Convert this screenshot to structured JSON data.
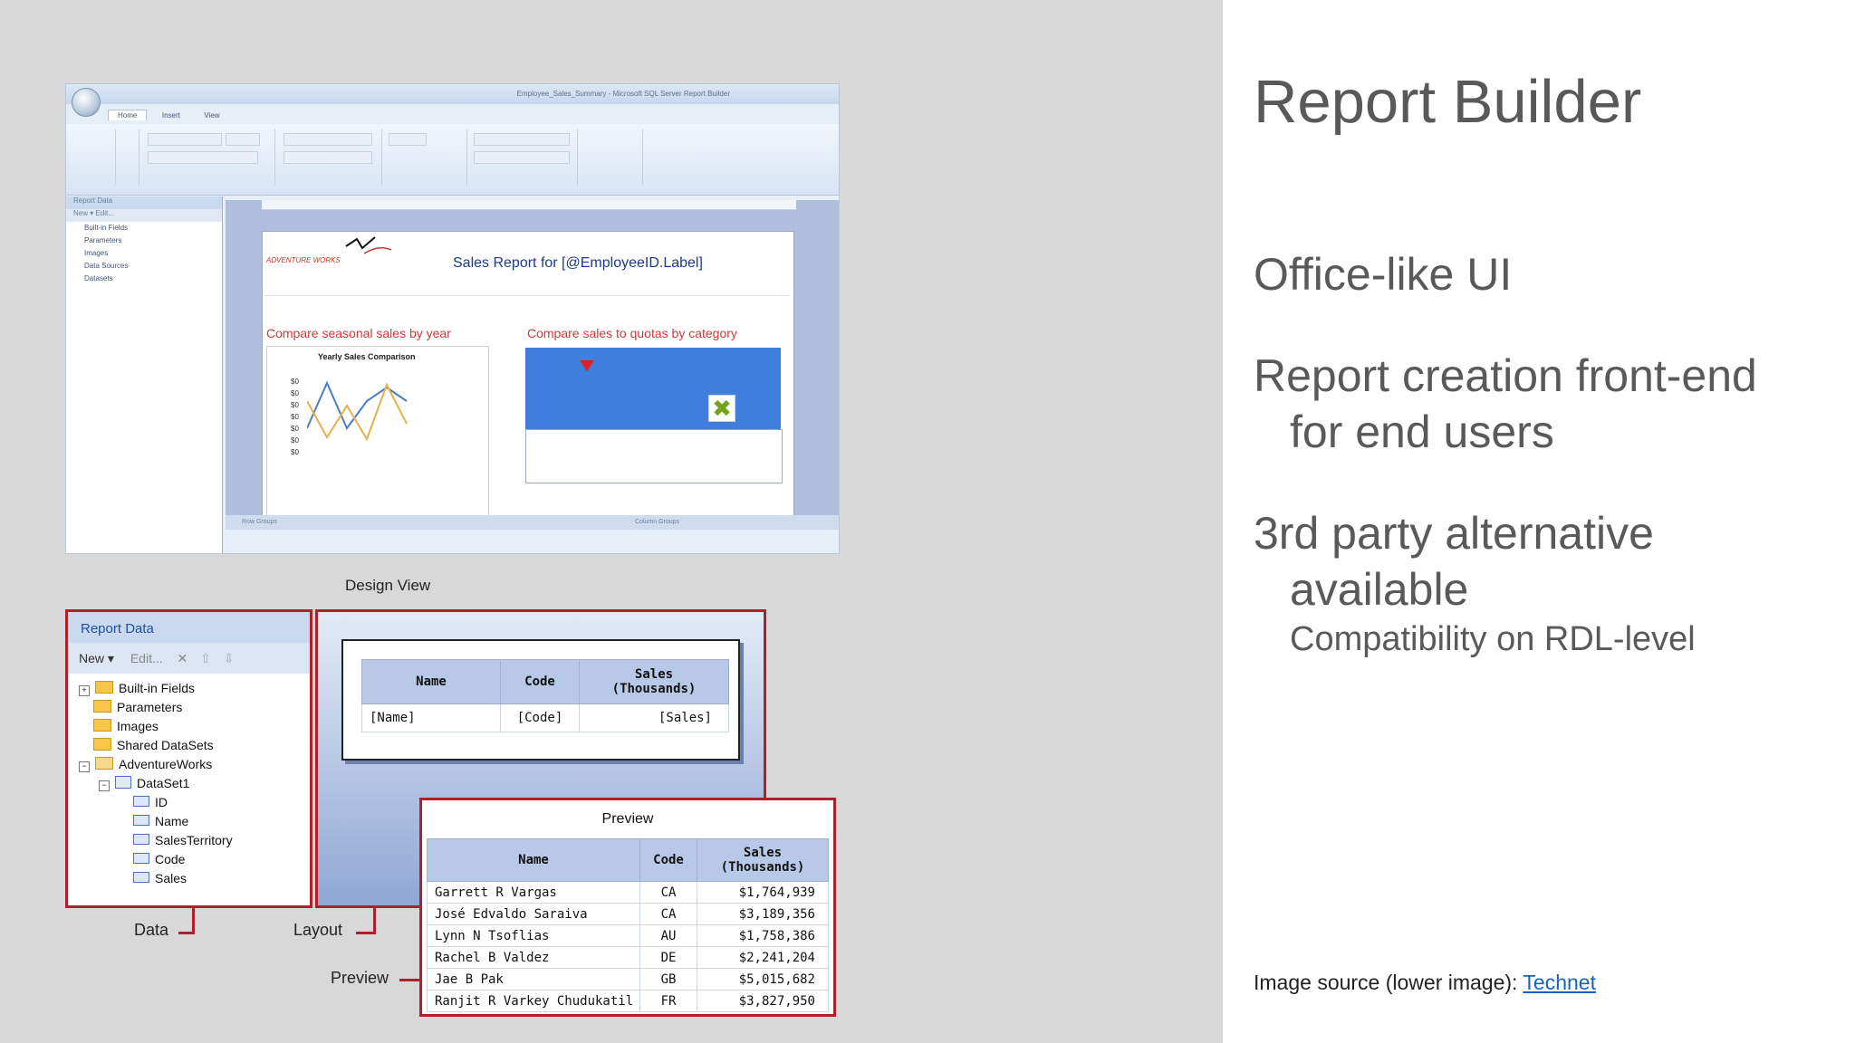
{
  "slide": {
    "title": "Report Builder",
    "bullets": [
      {
        "text": "Office-like UI"
      },
      {
        "text": "Report creation front-end",
        "cont": "for end users"
      },
      {
        "text": "3rd party alternative",
        "cont": "available",
        "sub": "Compatibility on RDL-level"
      }
    ],
    "source_prefix": "Image source (lower image): ",
    "source_link": "Technet"
  },
  "shot": {
    "window_title": "Employee_Sales_Summary - Microsoft SQL Server Report Builder",
    "tabs": [
      "Home",
      "Insert",
      "View"
    ],
    "pane_title": "Report Data",
    "pane_toolbar": "New ▾  Edit...",
    "pane_items": [
      "Built-in Fields",
      "Parameters",
      "Images",
      "Data Sources",
      "Datasets"
    ],
    "report_title": "Sales Report for [@EmployeeID.Label]",
    "section_left": "Compare seasonal sales by year",
    "chart_title": "Yearly Sales Comparison",
    "y_ticks": [
      "$0",
      "$0",
      "$0",
      "$0",
      "$0",
      "$0",
      "$0"
    ],
    "section_right": "Compare sales to quotas by category",
    "row_groups": "Row Groups",
    "column_groups": "Column Groups"
  },
  "captions": {
    "design_view": "Design View",
    "data": "Data",
    "layout": "Layout",
    "preview_label": "Preview"
  },
  "report_data": {
    "header": "Report Data",
    "toolbar_new": "New ▾",
    "toolbar_edit": "Edit...",
    "tree": [
      "Built-in Fields",
      "Parameters",
      "Images",
      "Shared DataSets",
      "AdventureWorks",
      "DataSet1",
      "ID",
      "Name",
      "SalesTerritory",
      "Code",
      "Sales"
    ]
  },
  "layout_table": {
    "headers": [
      "Name",
      "Code",
      "Sales\n(Thousands)"
    ],
    "row": [
      "[Name]",
      "[Code]",
      "[Sales]"
    ]
  },
  "preview": {
    "title": "Preview",
    "headers": [
      "Name",
      "Code",
      "Sales\n(Thousands)"
    ],
    "rows": [
      [
        "Garrett R Vargas",
        "CA",
        "$1,764,939"
      ],
      [
        "José Edvaldo Saraiva",
        "CA",
        "$3,189,356"
      ],
      [
        "Lynn N Tsoflias",
        "AU",
        "$1,758,386"
      ],
      [
        "Rachel B Valdez",
        "DE",
        "$2,241,204"
      ],
      [
        "Jae B Pak",
        "GB",
        "$5,015,682"
      ],
      [
        "Ranjit R Varkey Chudukatil",
        "FR",
        "$3,827,950"
      ]
    ]
  }
}
